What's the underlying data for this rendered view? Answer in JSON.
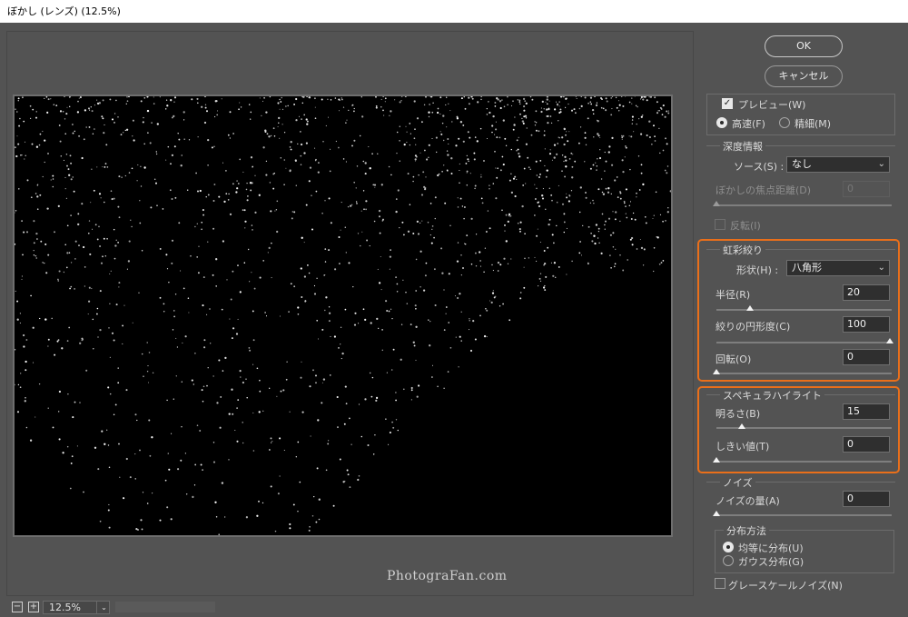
{
  "window": {
    "title": "ぼかし (レンズ) (12.5%)"
  },
  "buttons": {
    "ok": "OK",
    "cancel": "キャンセル"
  },
  "preview": {
    "checkbox_label": "プレビュー(W)",
    "checked": true,
    "quality": [
      {
        "label": "高速(F)",
        "selected": true
      },
      {
        "label": "精細(M)",
        "selected": false
      }
    ]
  },
  "depth": {
    "title": "深度情報",
    "source_label": "ソース(S) :",
    "source_value": "なし",
    "focal_label": "ぼかしの焦点距離(D)",
    "focal_value": "0",
    "invert_label": "反転(I)"
  },
  "iris": {
    "title": "虹彩絞り",
    "shape_label": "形状(H) :",
    "shape_value": "八角形",
    "radius_label": "半径(R)",
    "radius_value": "20",
    "curvature_label": "絞りの円形度(C)",
    "curvature_value": "100",
    "rotation_label": "回転(O)",
    "rotation_value": "0"
  },
  "specular": {
    "title": "スペキュラハイライト",
    "brightness_label": "明るさ(B)",
    "brightness_value": "15",
    "threshold_label": "しきい値(T)",
    "threshold_value": "0"
  },
  "noise": {
    "title": "ノイズ",
    "amount_label": "ノイズの量(A)",
    "amount_value": "0",
    "distribution_title": "分布方法",
    "distribution": [
      {
        "label": "均等に分布(U)",
        "selected": true
      },
      {
        "label": "ガウス分布(G)",
        "selected": false
      }
    ],
    "grayscale_label": "グレースケールノイズ(N)"
  },
  "zoom": {
    "value": "12.5%"
  },
  "watermark": "PhotograFan.com",
  "colors": {
    "highlight": "#ea6f1a",
    "panel": "#535353"
  }
}
